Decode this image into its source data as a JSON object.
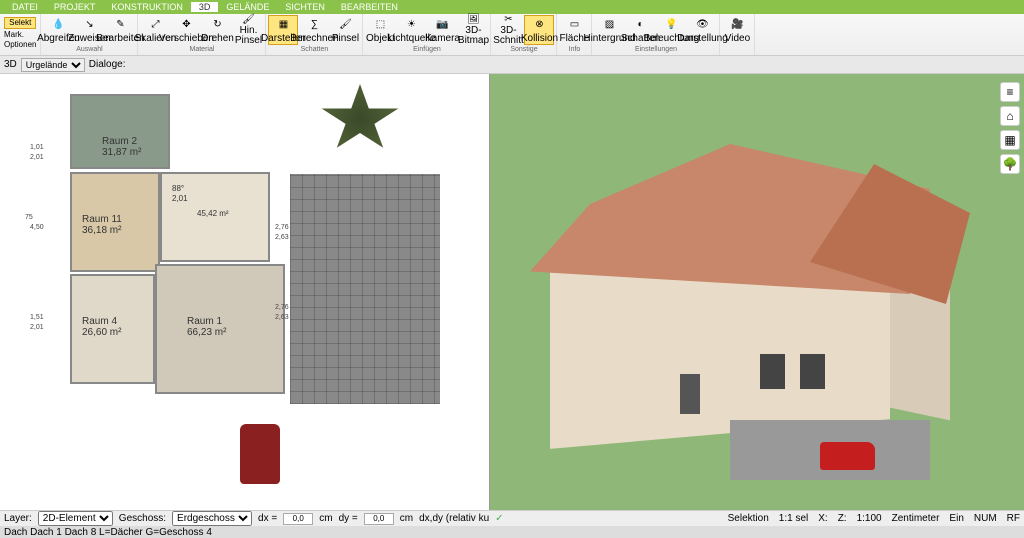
{
  "menubar": {
    "items": [
      "DATEI",
      "PROJEKT",
      "KONSTRUKTION",
      "3D",
      "GELÄNDE",
      "SICHTEN",
      "BEARBEITEN"
    ],
    "active_index": 3
  },
  "ribbon_left": {
    "select_label": "Selekt",
    "mark_label": "Mark.",
    "options_label": "Optionen"
  },
  "ribbon": {
    "groups": [
      {
        "label": "Auswahl",
        "buttons": [
          {
            "name": "abgreifen",
            "label": "Abgreifen"
          },
          {
            "name": "zuweisen",
            "label": "Zuweisen"
          },
          {
            "name": "bearbeiten",
            "label": "Bearbeiten"
          }
        ]
      },
      {
        "label": "Material",
        "buttons": [
          {
            "name": "skalieren",
            "label": "Skalieren"
          },
          {
            "name": "verschieben",
            "label": "Verschieben"
          },
          {
            "name": "drehen",
            "label": "Drehen"
          },
          {
            "name": "hinpinsel",
            "label": "Hin. Pinsel"
          }
        ]
      },
      {
        "label": "Schatten",
        "buttons": [
          {
            "name": "darstellen",
            "label": "Darstellen",
            "sel": true
          },
          {
            "name": "berechnen",
            "label": "Berechnen"
          },
          {
            "name": "pinsel",
            "label": "Pinsel"
          }
        ]
      },
      {
        "label": "Einfügen",
        "buttons": [
          {
            "name": "objekt",
            "label": "Objekt"
          },
          {
            "name": "lichtquelle",
            "label": "Lichtquelle"
          },
          {
            "name": "kamera",
            "label": "Kamera"
          },
          {
            "name": "3dbitmap",
            "label": "3D-Bitmap"
          }
        ]
      },
      {
        "label": "Sonstige",
        "buttons": [
          {
            "name": "3dschnitt",
            "label": "3D-Schnitt"
          },
          {
            "name": "kollision",
            "label": "Kollision",
            "sel": true
          }
        ]
      },
      {
        "label": "Info",
        "buttons": [
          {
            "name": "flaeche",
            "label": "Fläche"
          }
        ]
      },
      {
        "label": "Einstellungen",
        "buttons": [
          {
            "name": "hintergrund",
            "label": "Hintergrund"
          },
          {
            "name": "schatten-ein",
            "label": "Schatten"
          },
          {
            "name": "beleuchtung",
            "label": "Beleuchtung"
          },
          {
            "name": "darstellung",
            "label": "Darstellung"
          }
        ]
      },
      {
        "label": "",
        "buttons": [
          {
            "name": "video",
            "label": "Video"
          }
        ]
      }
    ]
  },
  "secondary": {
    "mode_label": "3D",
    "layer_select": "Urgelände",
    "dialoge_label": "Dialoge:"
  },
  "rooms": {
    "r1": {
      "name": "Raum 1",
      "area": "66,23 m²"
    },
    "r2": {
      "name": "Raum 2",
      "area": "31,87 m²"
    },
    "r4": {
      "name": "Raum 4",
      "area": "26,60 m²"
    },
    "r11": {
      "name": "Raum 11",
      "area": "36,18 m²"
    },
    "upper": {
      "area": "45,42 m²"
    }
  },
  "dimensions": {
    "d1": "1,01",
    "d2": "2,01",
    "d3": "4,50",
    "d4": "1,51",
    "d5": "2,01",
    "d6": "2,01",
    "d7": "88°",
    "d8": "2,01",
    "d9": "2,76",
    "d10": "2,63",
    "d11": "2,76",
    "d12": "2,63",
    "d13": "75"
  },
  "statusbar": {
    "layer_label": "Layer:",
    "layer_val": "2D-Element",
    "geschoss_label": "Geschoss:",
    "geschoss_val": "Erdgeschoss",
    "dx_label": "dx =",
    "dx_val": "0,0",
    "dx_unit": "cm",
    "dy_label": "dy =",
    "dy_val": "0,0",
    "dy_unit": "cm",
    "dxdy_label": "dx,dy (relativ ku"
  },
  "statusbar_right": {
    "selektion": "Selektion",
    "sel_count": "1:1 sel",
    "x": "X:",
    "z": "Z:",
    "scale": "1:100",
    "unit": "Zentimeter",
    "ein": "Ein",
    "num": "NUM",
    "rf": "RF"
  },
  "bottom": {
    "info": "Dach Dach 1 Dach 8 L=Dächer G=Geschoss 4"
  },
  "side_icons": [
    "layers-icon",
    "house-icon",
    "grid-icon",
    "tree-icon"
  ]
}
